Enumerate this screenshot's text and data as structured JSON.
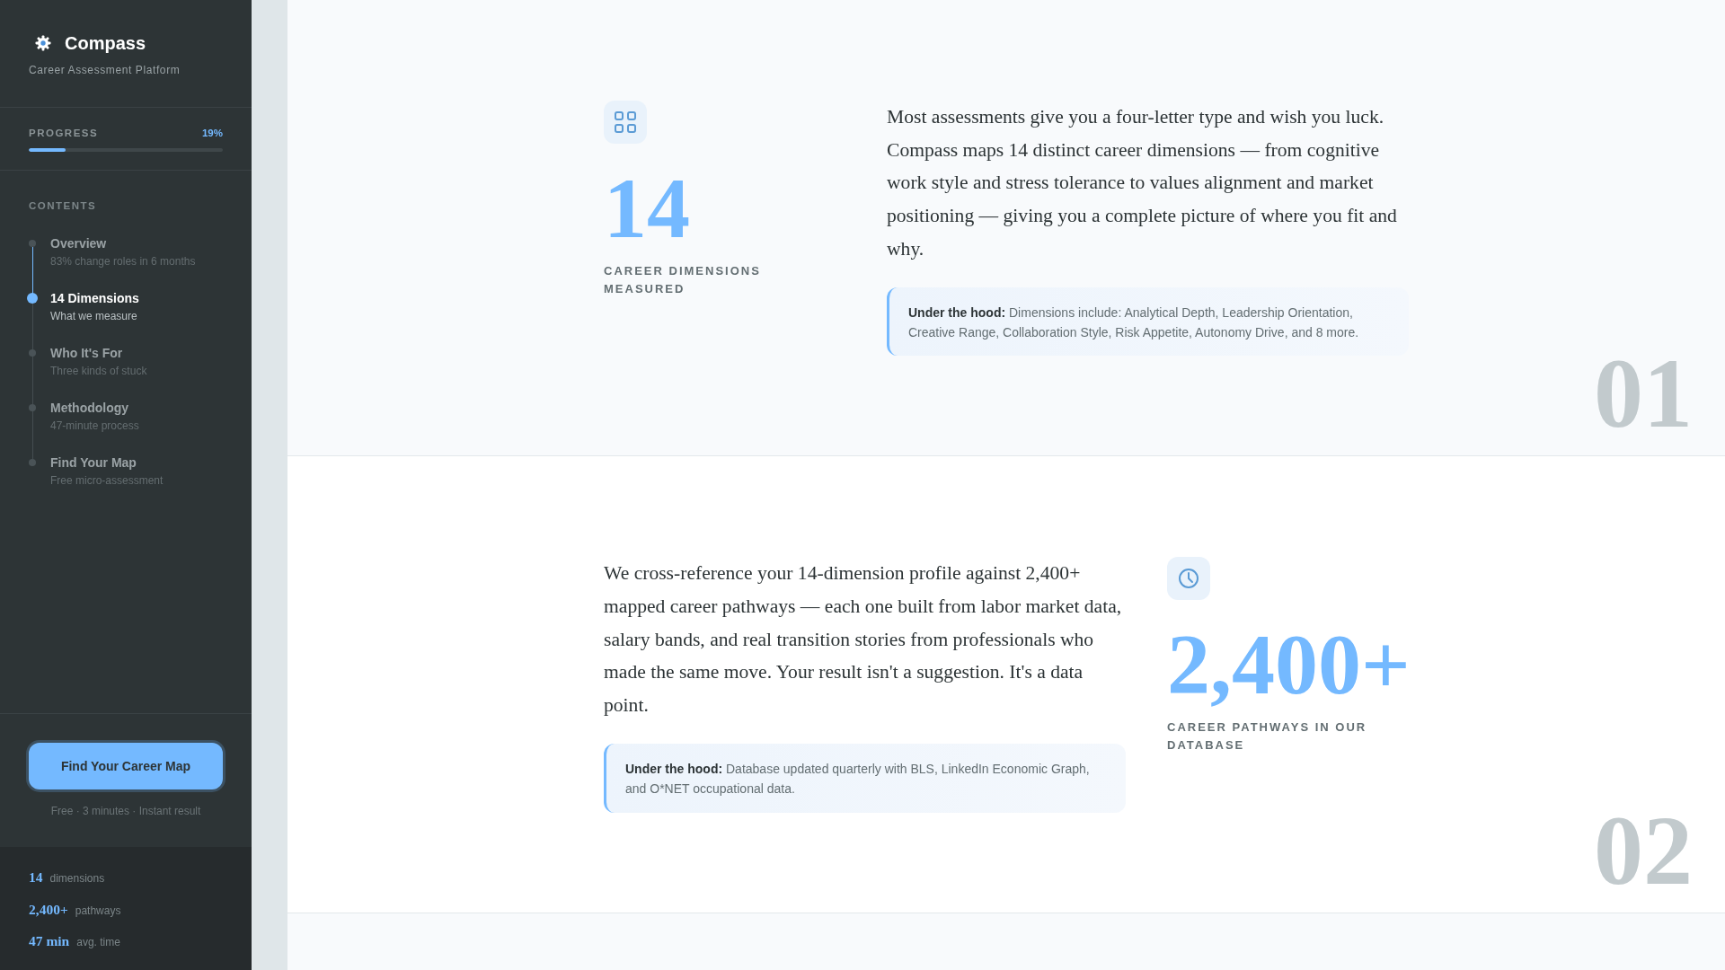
{
  "sidebar": {
    "brand": {
      "title": "Compass",
      "subtitle": "Career Assessment Platform"
    },
    "progress": {
      "label": "PROGRESS",
      "reading": "19%",
      "level": 0.19
    },
    "contents": {
      "heading": "CONTENTS",
      "timeline": {
        "level": 0.25
      },
      "items": [
        {
          "title": "Overview",
          "subtitle": "83% change roles in 6 months",
          "selected": false
        },
        {
          "title": "14 Dimensions",
          "subtitle": "What we measure",
          "selected": true
        },
        {
          "title": "Who It's For",
          "subtitle": "Three kinds of stuck",
          "selected": false
        },
        {
          "title": "Methodology",
          "subtitle": "47-minute process",
          "selected": false
        },
        {
          "title": "Find Your Map",
          "subtitle": "Free micro-assessment",
          "selected": false
        }
      ]
    },
    "cta": {
      "button": "Find Your Career Map",
      "note": "Free · 3 minutes · Instant result"
    },
    "stats": [
      {
        "value": "14",
        "label": "dimensions"
      },
      {
        "value": "2,400+",
        "label": "pathways"
      },
      {
        "value": "47 min",
        "label": "avg. time"
      }
    ]
  },
  "sections": [
    {
      "number": "01",
      "stat": {
        "value": "14",
        "label": "CAREER DIMENSIONS MEASURED"
      },
      "body": "Most assessments give you a four-letter type and wish you luck. Compass maps 14 distinct career dimensions — from cognitive work style and stress tolerance to values alignment and market positioning — giving you a complete picture of where you fit and why.",
      "callout": {
        "lead": "Under the hood:",
        "text": "Dimensions include: Analytical Depth, Leadership Orientation, Creative Range, Collaboration Style, Risk Appetite, Autonomy Drive, and 8 more."
      }
    },
    {
      "number": "02",
      "stat": {
        "value": "2,400+",
        "label": "CAREER PATHWAYS IN OUR DATABASE"
      },
      "body": "We cross-reference your 14-dimension profile against 2,400+ mapped career pathways — each one built from labor market data, salary bands, and real transition stories from professionals who made the same move. Your result isn't a suggestion. It's a data point.",
      "callout": {
        "lead": "Under the hood:",
        "text": "Database updated quarterly with BLS, LinkedIn Economic Graph, and O*NET occupational data."
      }
    }
  ]
}
